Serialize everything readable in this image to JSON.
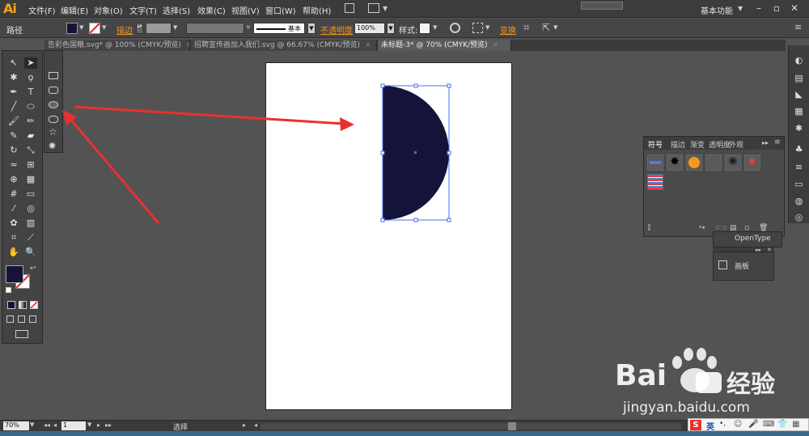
{
  "app": {
    "logo": "Ai",
    "workspace": "基本功能"
  },
  "menu": [
    "文件(F)",
    "编辑(E)",
    "对象(O)",
    "文字(T)",
    "选择(S)",
    "效果(C)",
    "视图(V)",
    "窗口(W)",
    "帮助(H)"
  ],
  "control": {
    "object_type": "路径",
    "stroke_label": "描边",
    "brush_label": "基本",
    "opacity_label": "不透明度",
    "opacity_value": "100%",
    "style_label": "样式:",
    "transform_label": "变换",
    "fill_color": "#14143a"
  },
  "tabs": [
    {
      "label": "告彩色国粮.svg* @ 100% (CMYK/预览)",
      "close": "×"
    },
    {
      "label": "招聘宣传画加入我们.svg @ 66.67% (CMYK/预览)",
      "close": "×"
    },
    {
      "label": "未标题-3* @ 70% (CMYK/预览)",
      "close": "×"
    }
  ],
  "symbols_panel": {
    "tabs": [
      "符号",
      "描边",
      "渐变",
      "透明度",
      "外观"
    ]
  },
  "opentype_panel": {
    "label": "OpenType"
  },
  "artboards_panel": {
    "label": "画板"
  },
  "status": {
    "zoom": "70%",
    "page": "1",
    "tool": "选择"
  },
  "watermark": {
    "brand": "Bai",
    "brand2": "经验",
    "url": "jingyan.baidu.com"
  },
  "ime": {
    "lang": "英"
  },
  "colors": {
    "fill": "#14143a",
    "selection": "#4a6cf0",
    "arrow": "#e8322d",
    "accent": "#f7931e"
  }
}
